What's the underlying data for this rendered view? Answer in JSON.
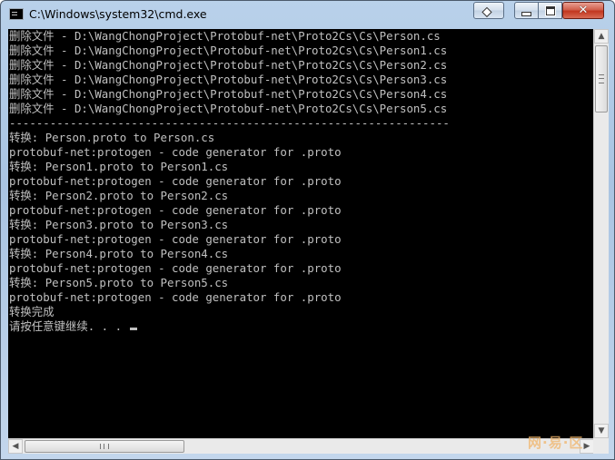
{
  "window": {
    "title": "C:\\Windows\\system32\\cmd.exe",
    "close_symbol": "✕"
  },
  "console": {
    "lines": [
      "删除文件 - D:\\WangChongProject\\Protobuf-net\\Proto2Cs\\Cs\\Person.cs",
      "删除文件 - D:\\WangChongProject\\Protobuf-net\\Proto2Cs\\Cs\\Person1.cs",
      "删除文件 - D:\\WangChongProject\\Protobuf-net\\Proto2Cs\\Cs\\Person2.cs",
      "删除文件 - D:\\WangChongProject\\Protobuf-net\\Proto2Cs\\Cs\\Person3.cs",
      "删除文件 - D:\\WangChongProject\\Protobuf-net\\Proto2Cs\\Cs\\Person4.cs",
      "删除文件 - D:\\WangChongProject\\Protobuf-net\\Proto2Cs\\Cs\\Person5.cs",
      "-----------------------------------------------------------------",
      "转换: Person.proto to Person.cs",
      "protobuf-net:protogen - code generator for .proto",
      "转换: Person1.proto to Person1.cs",
      "protobuf-net:protogen - code generator for .proto",
      "转换: Person2.proto to Person2.cs",
      "protobuf-net:protogen - code generator for .proto",
      "转换: Person3.proto to Person3.cs",
      "protobuf-net:protogen - code generator for .proto",
      "转换: Person4.proto to Person4.cs",
      "protobuf-net:protogen - code generator for .proto",
      "转换: Person5.proto to Person5.cs",
      "protobuf-net:protogen - code generator for .proto",
      "转换完成",
      "请按任意键继续. . . "
    ],
    "text_color": "#c0c0c0",
    "background": "#000000"
  },
  "scrollbars": {
    "up_arrow": "▲",
    "down_arrow": "▼",
    "left_arrow": "◀",
    "right_arrow": "▶"
  },
  "watermark": "网·易·区"
}
